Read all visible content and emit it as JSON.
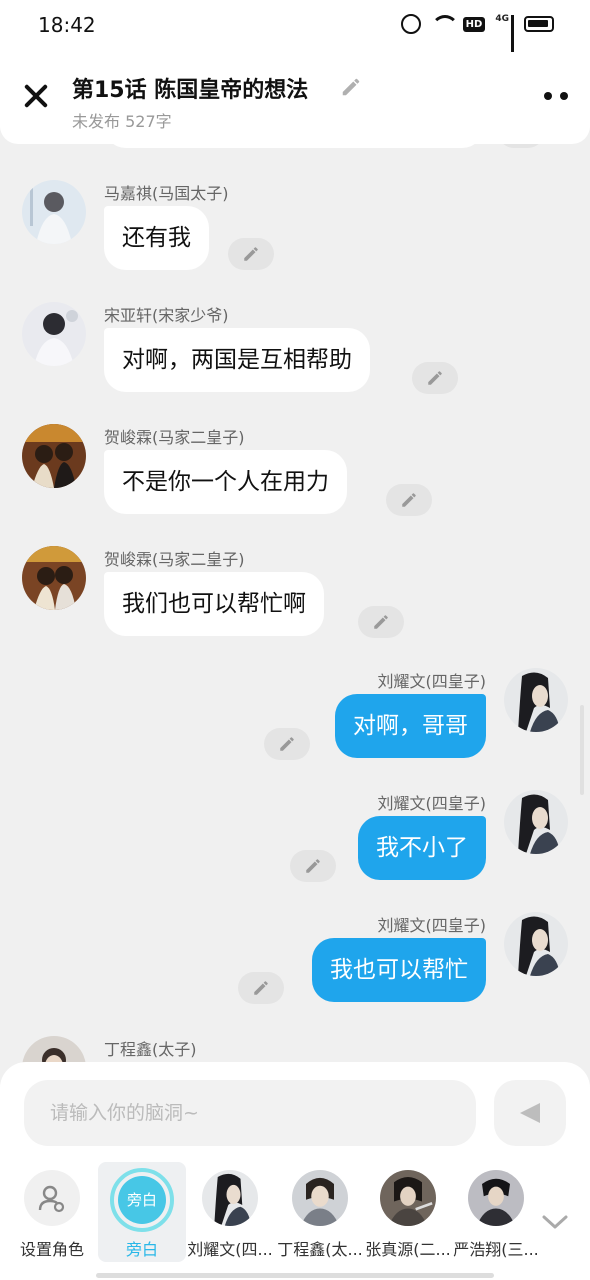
{
  "status_bar": {
    "time": "18:42",
    "network": "4G",
    "hd": "HD"
  },
  "header": {
    "title": "第15话  陈国皇帝的想法",
    "subtitle": "未发布 527字"
  },
  "messages": [
    {
      "side": "left",
      "sender": "马嘉祺(马国太子)",
      "text": "还有我"
    },
    {
      "side": "left",
      "sender": "宋亚轩(宋家少爷)",
      "text": "对啊，两国是互相帮助"
    },
    {
      "side": "left",
      "sender": "贺峻霖(马家二皇子)",
      "text": "不是你一个人在用力"
    },
    {
      "side": "left",
      "sender": "贺峻霖(马家二皇子)",
      "text": "我们也可以帮忙啊"
    },
    {
      "side": "right",
      "sender": "刘耀文(四皇子)",
      "text": "对啊，哥哥"
    },
    {
      "side": "right",
      "sender": "刘耀文(四皇子)",
      "text": "我不小了"
    },
    {
      "side": "right",
      "sender": "刘耀文(四皇子)",
      "text": "我也可以帮忙"
    },
    {
      "side": "left",
      "sender": "丁程鑫(太子)",
      "text": ""
    }
  ],
  "composer": {
    "placeholder": "请输入你的脑洞~"
  },
  "roles": [
    {
      "label": "设置角色",
      "icon": "user-settings-icon"
    },
    {
      "label": "旁白",
      "badge": "旁白",
      "active": true
    },
    {
      "label": "刘耀文(四...",
      "avatar_color": "#3a4250"
    },
    {
      "label": "丁程鑫(太...",
      "avatar_color": "#7a7f88"
    },
    {
      "label": "张真源(二...",
      "avatar_color": "#4a4440"
    },
    {
      "label": "严浩翔(三...",
      "avatar_color": "#2e2e34"
    }
  ],
  "colors": {
    "accent": "#1fa5ec",
    "narrator": "#47c7e6",
    "bubble_left": "#ffffff",
    "background": "#f0f0f0"
  }
}
